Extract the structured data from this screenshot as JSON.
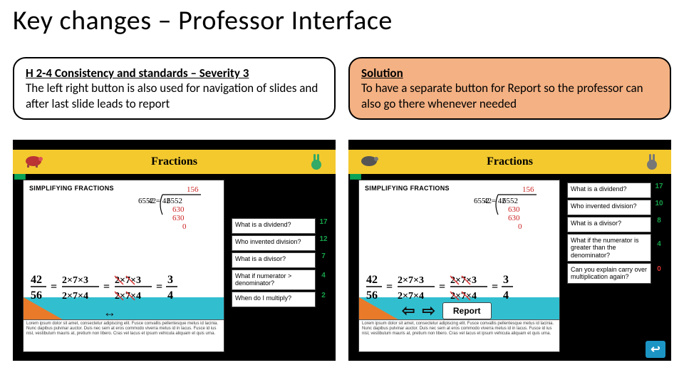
{
  "title": "Key changes – Professor Interface",
  "left_callout": {
    "heading": "H 2-4 Consistency and standards – Severity 3",
    "body": "The left right button is also used for navigation of slides and after last slide leads to report"
  },
  "right_callout": {
    "heading": "Solution",
    "body": "To have a separate button for Report so the professor can also go there whenever needed"
  },
  "screenshot": {
    "header_title": "Fractions",
    "subheading": "SIMPLIFYING FRACTIONS",
    "fraction_equation": "42/56 = 2×7×3 / 2×7×4 = 2×7×3 / 2×7×4 = 3/4",
    "long_division": {
      "dividend": "6552",
      "divisor": "42",
      "q": "156",
      "l1": "6552",
      "l2": "630",
      "l3": "630",
      "l4": "0"
    },
    "lorem": "Lorem ipsum dolor sit amet, consectetur adipiscing elit. Fusce convallis pellentesque metus id lacinia. Nunc dapibus pulvinar auctor. Duis nec sem at eros commodo viverra metus id in lacus. Fusce id ius nisl, vestibulum mauris at, pretium non libero. Cras vel lacus et ipsum vehicula aliquam et quis urna.",
    "nav_arrows": "↔",
    "report_button": "Report",
    "big_arrows": {
      "left": "⇦",
      "right": "⇨"
    }
  },
  "questions_left": [
    {
      "q": "What is a dividend?",
      "n": "17"
    },
    {
      "q": "Who invented division?",
      "n": "12"
    },
    {
      "q": "What is a divisor?",
      "n": "7"
    },
    {
      "q": "What if numerator > denominator?",
      "n": "4"
    },
    {
      "q": "When do I multiply?",
      "n": "2"
    }
  ],
  "questions_right": [
    {
      "q": "What is a dividend?",
      "n": "17"
    },
    {
      "q": "Who invented division?",
      "n": "10"
    },
    {
      "q": "What is a divisor?",
      "n": "8"
    },
    {
      "q": "What if the numerator is greater than the denominator?",
      "n": "4"
    },
    {
      "q": "Can you explain carry over multiplication again?",
      "n": "0"
    }
  ]
}
